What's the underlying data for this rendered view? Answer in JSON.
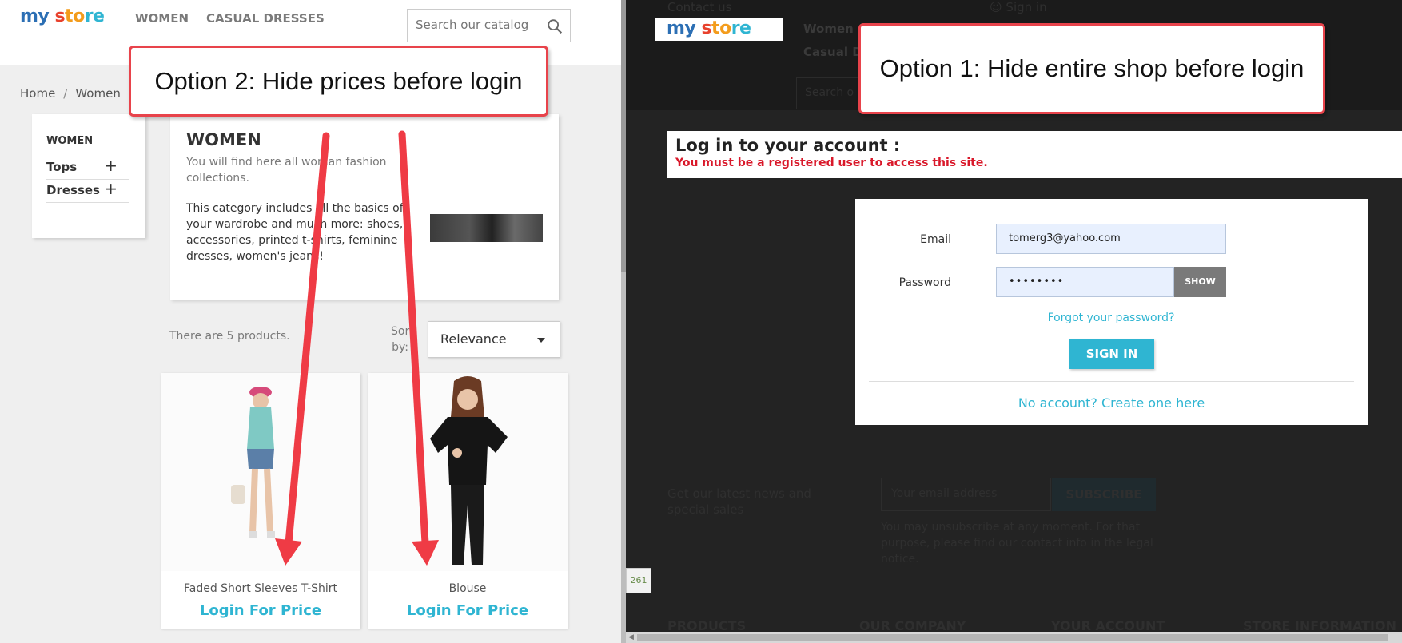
{
  "left": {
    "logo": {
      "my": "my",
      "s": "s",
      "to": "to",
      "re": "re"
    },
    "nav": {
      "women": "WOMEN",
      "casual": "CASUAL DRESSES"
    },
    "search": {
      "placeholder": "Search our catalog"
    },
    "breadcrumb": {
      "home": "Home",
      "sep": "/",
      "women": "Women"
    },
    "sidebar": {
      "title": "WOMEN",
      "items": [
        {
          "label": "Tops",
          "toggle": "+"
        },
        {
          "label": "Dresses",
          "toggle": "+"
        }
      ]
    },
    "category": {
      "title": "WOMEN",
      "desc1": "You will find here all woman fashion collections.",
      "desc2": "This category includes all the basics of your wardrobe and much more: shoes, accessories, printed t-shirts, feminine dresses, women's jeans!"
    },
    "listing": {
      "count": "There are 5 products.",
      "sort_label": "Sort by:",
      "sort_value": "Relevance"
    },
    "products": [
      {
        "name": "Faded Short Sleeves T-Shirt",
        "price": "Login For Price"
      },
      {
        "name": "Blouse",
        "price": "Login For Price"
      }
    ]
  },
  "right": {
    "header": {
      "contact": "Contact us",
      "signin": "Sign in",
      "nav_women": "Women",
      "nav_casual": "Casual D",
      "search": "Search o"
    },
    "login": {
      "title": "Log in to your account :",
      "warning": "You must be a registered user to access this site.",
      "email_label": "Email",
      "email_value": "tomerg3@yahoo.com",
      "password_label": "Password",
      "password_value": "••••••••",
      "show": "SHOW",
      "forgot": "Forgot your password?",
      "signin": "SIGN IN",
      "create": "No account? Create one here"
    },
    "newsletter": {
      "text": "Get our latest news and special sales",
      "placeholder": "Your email address",
      "button": "SUBSCRIBE",
      "note": "You may unsubscribe at any moment. For that purpose, please find our contact info in the legal notice."
    },
    "badge": "261",
    "footer": [
      "PRODUCTS",
      "OUR COMPANY",
      "YOUR ACCOUNT",
      "STORE INFORMATION"
    ]
  },
  "callouts": {
    "option2": "Option 2: Hide prices before login",
    "option1": "Option 1: Hide entire shop before login"
  },
  "colors": {
    "accent": "#2fb5d2",
    "callout_border": "#e8434b",
    "warning": "#d9182a",
    "arrow": "#ef3b45"
  }
}
